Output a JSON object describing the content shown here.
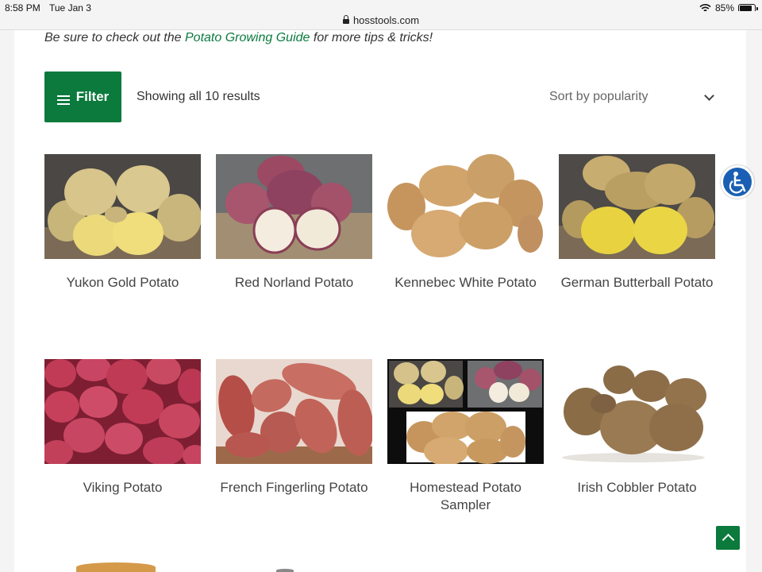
{
  "status_bar": {
    "time": "8:58 PM",
    "date": "Tue Jan 3",
    "battery": "85%"
  },
  "browser": {
    "url": "hosstools.com"
  },
  "tips": {
    "prefix": "Be sure to check out the ",
    "link": "Potato Growing Guide",
    "suffix": " for more tips & tricks!"
  },
  "toolbar": {
    "filter_label": "Filter",
    "results_text": "Showing all 10 results",
    "sort_label": "Sort by popularity"
  },
  "products": [
    {
      "name": "Yukon Gold Potato",
      "image": "yukon-gold-potato-photo"
    },
    {
      "name": "Red Norland Potato",
      "image": "red-norland-potato-photo"
    },
    {
      "name": "Kennebec White Potato",
      "image": "kennebec-white-potato-photo"
    },
    {
      "name": "German Butterball Potato",
      "image": "german-butterball-potato-photo"
    },
    {
      "name": "Viking Potato",
      "image": "viking-potato-photo"
    },
    {
      "name": "French Fingerling Potato",
      "image": "french-fingerling-potato-photo"
    },
    {
      "name": "Homestead Potato Sampler",
      "image": "homestead-sampler-photo"
    },
    {
      "name": "Irish Cobbler Potato",
      "image": "irish-cobbler-potato-photo"
    }
  ],
  "icons": {
    "accessibility": "wheelchair-icon",
    "scroll_top": "chevron-up-icon",
    "menu": "hamburger-icon",
    "sort": "chevron-down-icon"
  },
  "colors": {
    "brand_green": "#0b7a3c",
    "accessibility_blue": "#1a5fb4"
  }
}
